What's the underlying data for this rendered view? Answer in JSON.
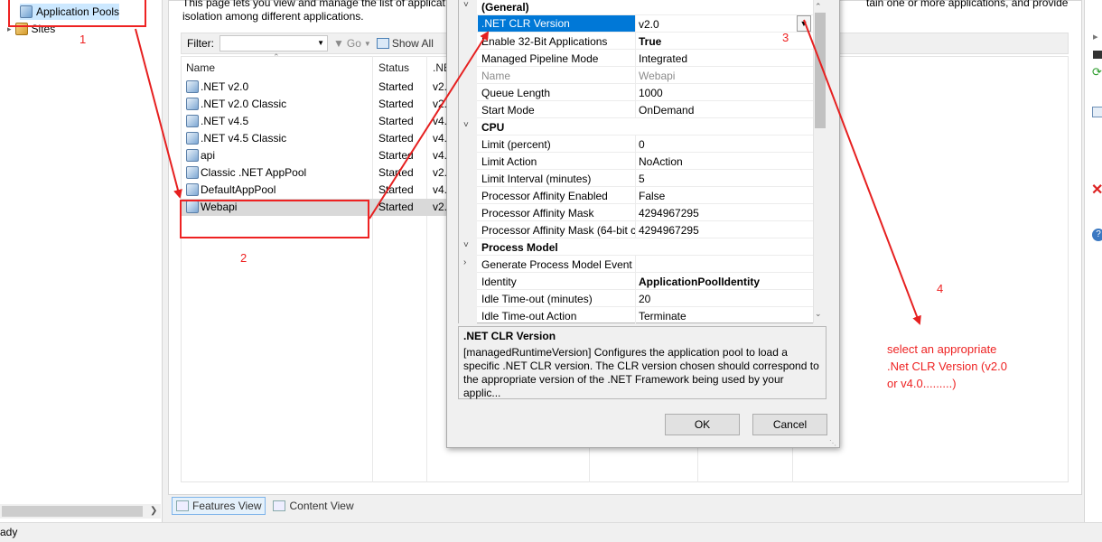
{
  "tree": {
    "items": [
      {
        "label": "Application Pools",
        "icon": "app-pools-icon"
      },
      {
        "label": "Sites",
        "icon": "sites-icon"
      }
    ]
  },
  "main": {
    "description_line1": "This page lets you view and manage the list of applicat",
    "description_line2": "isolation among different applications.",
    "description_tail": "tain one or more applications, and provide",
    "filter_label": "Filter:",
    "go_label": "Go",
    "show_all_label": "Show All",
    "columns": [
      "Name",
      "Status",
      ".NE"
    ],
    "rows": [
      {
        "name": ".NET v2.0",
        "status": "Started",
        "ver": "v2."
      },
      {
        "name": ".NET v2.0 Classic",
        "status": "Started",
        "ver": "v2."
      },
      {
        "name": ".NET v4.5",
        "status": "Started",
        "ver": "v4."
      },
      {
        "name": ".NET v4.5 Classic",
        "status": "Started",
        "ver": "v4."
      },
      {
        "name": "api",
        "status": "Started",
        "ver": "v4."
      },
      {
        "name": "Classic .NET AppPool",
        "status": "Started",
        "ver": "v2."
      },
      {
        "name": "DefaultAppPool",
        "status": "Started",
        "ver": "v4."
      },
      {
        "name": "Webapi",
        "status": "Started",
        "ver": "v2."
      }
    ],
    "tabs": {
      "features": "Features View",
      "content": "Content View"
    }
  },
  "statusbar": {
    "text": "ady"
  },
  "dialog": {
    "properties": [
      {
        "kind": "cat",
        "name": "(General)"
      },
      {
        "kind": "prop",
        "name": ".NET CLR Version",
        "value": "v2.0",
        "selected": true
      },
      {
        "kind": "prop",
        "name": "Enable 32-Bit Applications",
        "value": "True",
        "bold": true
      },
      {
        "kind": "prop",
        "name": "Managed Pipeline Mode",
        "value": "Integrated"
      },
      {
        "kind": "prop",
        "name": "Name",
        "value": "Webapi",
        "dim": true
      },
      {
        "kind": "prop",
        "name": "Queue Length",
        "value": "1000"
      },
      {
        "kind": "prop",
        "name": "Start Mode",
        "value": "OnDemand"
      },
      {
        "kind": "cat",
        "name": "CPU"
      },
      {
        "kind": "prop",
        "name": "Limit (percent)",
        "value": "0"
      },
      {
        "kind": "prop",
        "name": "Limit Action",
        "value": "NoAction"
      },
      {
        "kind": "prop",
        "name": "Limit Interval (minutes)",
        "value": "5"
      },
      {
        "kind": "prop",
        "name": "Processor Affinity Enabled",
        "value": "False"
      },
      {
        "kind": "prop",
        "name": "Processor Affinity Mask",
        "value": "4294967295"
      },
      {
        "kind": "prop",
        "name": "Processor Affinity Mask (64-bit c",
        "value": "4294967295"
      },
      {
        "kind": "cat",
        "name": "Process Model"
      },
      {
        "kind": "sub",
        "name": "Generate Process Model Event L",
        "value": ""
      },
      {
        "kind": "prop",
        "name": "Identity",
        "value": "ApplicationPoolIdentity",
        "bold": true
      },
      {
        "kind": "prop",
        "name": "Idle Time-out (minutes)",
        "value": "20"
      },
      {
        "kind": "prop",
        "name": "Idle Time-out Action",
        "value": "Terminate"
      }
    ],
    "help_title": ".NET CLR Version",
    "help_text": " [managedRuntimeVersion] Configures the application pool to load a specific .NET CLR version.  The CLR version chosen should correspond to the appropriate version of the .NET Framework being used by your applic...",
    "ok_label": "OK",
    "cancel_label": "Cancel"
  },
  "annotations": {
    "n1": "1",
    "n2": "2",
    "n3": "3",
    "n4": "4",
    "note_line1": "select an appropriate",
    "note_line2": ".Net CLR Version (v2.0",
    "note_line3": "or v4.0.........)",
    "color": "#e62020"
  }
}
